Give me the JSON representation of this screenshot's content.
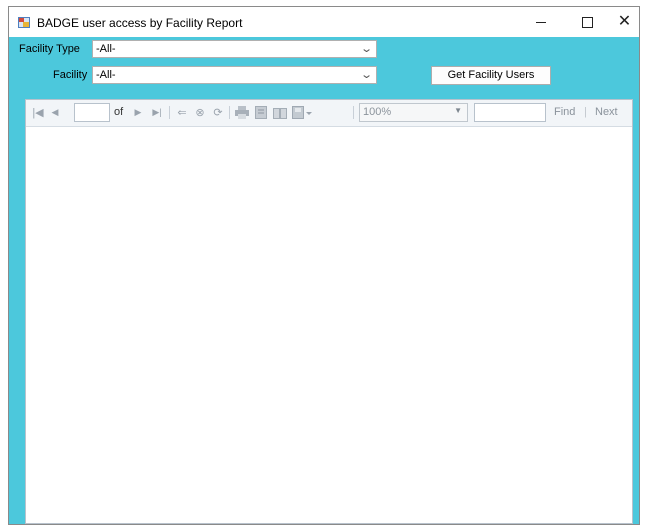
{
  "window": {
    "title": "BADGE user access by Facility Report"
  },
  "filters": {
    "facility_type_label": "Facility Type",
    "facility_type_value": "-All-",
    "facility_label": "Facility",
    "facility_value": "-All-",
    "get_users_button": "Get Facility Users"
  },
  "report_toolbar": {
    "page_value": "",
    "of_label": "of",
    "zoom_value": "100%",
    "find_value": "",
    "find_label": "Find",
    "find_sep": "|",
    "next_label": "Next"
  },
  "colors": {
    "form_background": "#4cc8dc",
    "toolbar_background": "#f2f5f8"
  },
  "icons": [
    "app-icon",
    "minimize-icon",
    "maximize-icon",
    "close-icon",
    "first-page-icon",
    "previous-page-icon",
    "next-page-icon",
    "last-page-icon",
    "back-icon",
    "stop-icon",
    "refresh-icon",
    "print-icon",
    "print-layout-icon",
    "page-setup-icon",
    "export-icon"
  ]
}
